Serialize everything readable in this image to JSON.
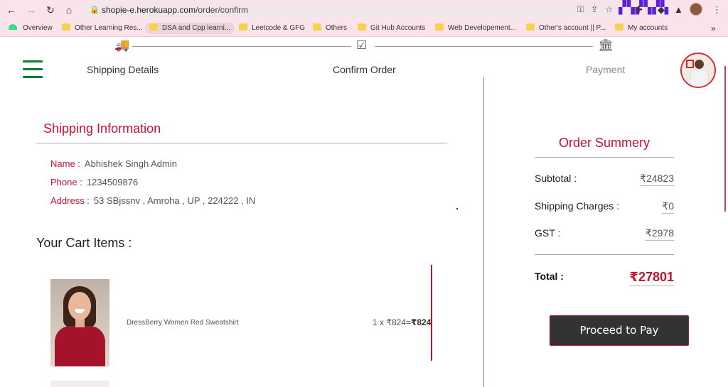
{
  "browser": {
    "back": "←",
    "forward": "→",
    "reload": "↻",
    "home": "⌂",
    "url_host": "shopie-e.herokuapp.com",
    "url_path": "/order/confirm",
    "bookmarks": [
      {
        "label": "Overview",
        "icon": "android-icon"
      },
      {
        "label": "Other Learning Res..."
      },
      {
        "label": "DSA and Cpp learni..."
      },
      {
        "label": "Leetcode & GFG"
      },
      {
        "label": "Others"
      },
      {
        "label": "Git Hub Accounts"
      },
      {
        "label": "Web Developement..."
      },
      {
        "label": "Other's account || P..."
      },
      {
        "label": "My accounts"
      }
    ],
    "bookmarks_more": "»"
  },
  "steps": [
    {
      "label": "Shipping Details",
      "icon": "truck-icon",
      "state": "done"
    },
    {
      "label": "Confirm Order",
      "icon": "check-square-icon",
      "state": "active"
    },
    {
      "label": "Payment",
      "icon": "bank-icon",
      "state": "pending"
    }
  ],
  "shipping": {
    "title": "Shipping Information",
    "name_label": "Name :",
    "name": "Abhishek Singh Admin",
    "phone_label": "Phone :",
    "phone": "1234509876",
    "address_label": "Address :",
    "address": "53 SBjssnv , Amroha , UP , 224222 , IN"
  },
  "cart": {
    "title": "Your Cart Items :",
    "items": [
      {
        "name": "DressBerry Women Red Sweatshirt",
        "qty_price": "1 x ₹824=",
        "subtotal": "₹824"
      }
    ]
  },
  "summary": {
    "title": "Order Summery",
    "subtotal_label": "Subtotal :",
    "subtotal": "₹24823",
    "shipping_label": "Shipping Charges :",
    "shipping": "₹0",
    "gst_label": "GST :",
    "gst": "₹2978",
    "total_label": "Total :",
    "total": "₹27801",
    "pay_button": "Proceed to Pay"
  },
  "colors": {
    "accent": "#c8102e",
    "success": "#0a8a2a",
    "button": "#333333"
  }
}
